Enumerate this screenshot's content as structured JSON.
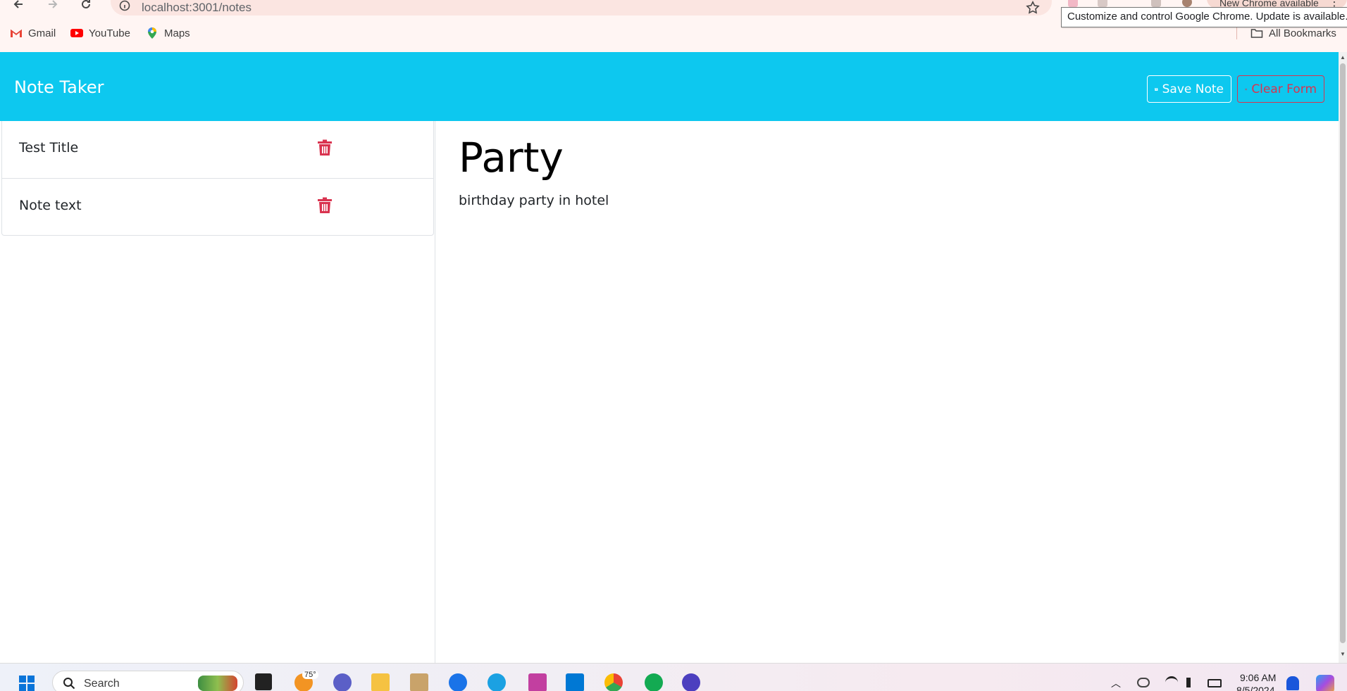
{
  "browser": {
    "url": "localhost:3001/notes",
    "update_label": "New Chrome available",
    "tooltip": "Customize and control Google Chrome. Update is available.",
    "bookmarks": [
      {
        "label": "Gmail",
        "icon": "gmail-icon"
      },
      {
        "label": "YouTube",
        "icon": "youtube-icon"
      },
      {
        "label": "Maps",
        "icon": "maps-icon"
      }
    ],
    "all_bookmarks": "All Bookmarks"
  },
  "app": {
    "title": "Note Taker",
    "save_label": "Save Note",
    "clear_label": "Clear Form",
    "notes": [
      {
        "title": "Test Title"
      },
      {
        "title": "Note text"
      }
    ],
    "active_note": {
      "title": "Party",
      "text": "birthday party in hotel"
    }
  },
  "taskbar": {
    "search_placeholder": "Search",
    "weather_temp": "75°",
    "time": "9:06 AM",
    "date": "8/5/2024"
  },
  "colors": {
    "header": "#0dc8ef",
    "danger": "#d9334f",
    "chrome_bg": "#fff5f3"
  }
}
